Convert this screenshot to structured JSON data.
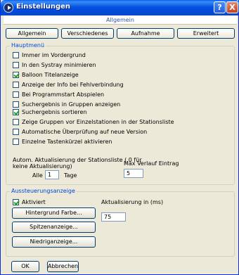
{
  "window": {
    "title": "Einstellungen"
  },
  "titlebar_buttons": {
    "help": "?",
    "close": "X"
  },
  "header": {
    "text": "Allgemein"
  },
  "tabs": [
    "Allgemein",
    "Verschiedenes",
    "Aufnahme",
    "Erweitert"
  ],
  "hauptmenu": {
    "legend": "Hauptmenü",
    "options": [
      {
        "label": "Immer im Vordergrund",
        "checked": false
      },
      {
        "label": "In den Systray minimieren",
        "checked": false
      },
      {
        "label": "Balloon Titelanzeige",
        "checked": true
      },
      {
        "label": "Anzeige der Info bei Fehlverbindung",
        "checked": false
      },
      {
        "label": "Bei Programmstart Abspielen",
        "checked": false
      },
      {
        "label": "Suchergebnis in Gruppen anzeigen",
        "checked": false
      },
      {
        "label": "Suchergebnis sortieren",
        "checked": true
      },
      {
        "label": "Zeige Gruppen vor Einzelstationen in der Stationsliste",
        "checked": false
      },
      {
        "label": "Automatische Überprüfung auf neue Version",
        "checked": false
      },
      {
        "label": "Einzelne Tastenkürzel aktivieren",
        "checked": false
      }
    ],
    "autom_label_line1": "Autom. Aktualisierung der Stationsliste    ( 0 für",
    "autom_label_line2": "keine  Aktualisierung)",
    "alle_label": "Alle",
    "alle_value": "1",
    "tage_label": "Tage",
    "max_verlauf_label": "Max Verlauf Eintrag",
    "max_verlauf_value": "5"
  },
  "aussteuerung": {
    "legend": "Aussteuerungsanzeige",
    "aktiviert_label": "Aktiviert",
    "aktiviert_checked": true,
    "aktualisierung_label": "Aktualisierung in (ms)",
    "aktualisierung_value": "75",
    "buttons": [
      "Hintergrund Farbe...",
      "Spitzenanzeige...",
      "Niedriganzeige..."
    ]
  },
  "footer": {
    "ok": "OK",
    "cancel": "Abbrechen"
  }
}
